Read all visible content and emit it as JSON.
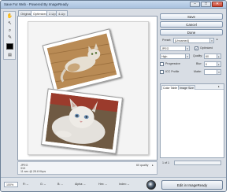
{
  "window": {
    "title": "Save For Web - Powered By ImageReady",
    "minimize_glyph": "–",
    "maximize_glyph": "□",
    "close_glyph": "✕"
  },
  "toolbox": {
    "tools": [
      "hand-icon",
      "slice-select-icon",
      "zoom-icon",
      "eyedropper-icon"
    ],
    "glyphs": [
      "✋",
      "↖",
      "⌕",
      "✎"
    ],
    "swatch_color": "#000000",
    "toggle_glyph": "▤"
  },
  "view_tabs": [
    "Original",
    "Optimized",
    "2-Up",
    "4-Up"
  ],
  "active_tab": 1,
  "canvas_status": {
    "format": "JPEG",
    "size": "31K",
    "time": "11 sec @ 28.8 Kbps",
    "quality": "60 quality",
    "menu_glyph": "▸"
  },
  "buttons": {
    "save": "Save",
    "cancel": "Cancel",
    "done": "Done"
  },
  "settings": {
    "preset_label": "Preset:",
    "preset_value": "[Unnamed]",
    "format_value": "JPEG",
    "compression_value": "High",
    "optimized_label": "Optimized",
    "optimized_checked": true,
    "quality_label": "Quality:",
    "quality_value": "60",
    "progressive_label": "Progressive",
    "blur_label": "Blur:",
    "blur_value": "0",
    "icc_label": "ICC Profile",
    "matte_label": "Matte:",
    "arrow_glyph": "▾",
    "menu_glyph": "▸"
  },
  "color_table": {
    "tabs": [
      "Color Table",
      "Image Size"
    ],
    "count": "",
    "page_text": "1 of 1"
  },
  "bottom": {
    "zoom_value": "100%",
    "readouts": [
      "R: --",
      "G: --",
      "B: --",
      "Alpha: --",
      "Hex: --",
      "Index: --"
    ],
    "edit_button": "Edit in ImageReady"
  },
  "colors": {
    "titlebar": "#a9c2df",
    "frame": "#d8dde4",
    "canvas_bg": "#ffffff"
  }
}
